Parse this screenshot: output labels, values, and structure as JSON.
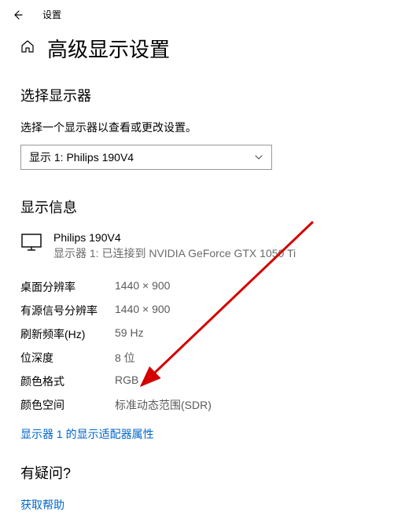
{
  "titlebar": {
    "label": "设置"
  },
  "page_title": "高级显示设置",
  "select_display": {
    "heading": "选择显示器",
    "subtext": "选择一个显示器以查看或更改设置。",
    "dropdown_value": "显示 1: Philips 190V4"
  },
  "display_info": {
    "heading": "显示信息",
    "monitor_name": "Philips 190V4",
    "monitor_connection": "显示器 1: 已连接到 NVIDIA GeForce GTX 1050 Ti",
    "specs": [
      {
        "label": "桌面分辨率",
        "value": "1440 × 900"
      },
      {
        "label": "有源信号分辨率",
        "value": "1440 × 900"
      },
      {
        "label": "刷新频率(Hz)",
        "value": "59 Hz"
      },
      {
        "label": "位深度",
        "value": "8 位"
      },
      {
        "label": "颜色格式",
        "value": "RGB"
      },
      {
        "label": "颜色空间",
        "value": "标准动态范围(SDR)"
      }
    ],
    "adapter_link": "显示器 1 的显示适配器属性"
  },
  "help": {
    "heading": "有疑问?",
    "link": "获取帮助"
  }
}
